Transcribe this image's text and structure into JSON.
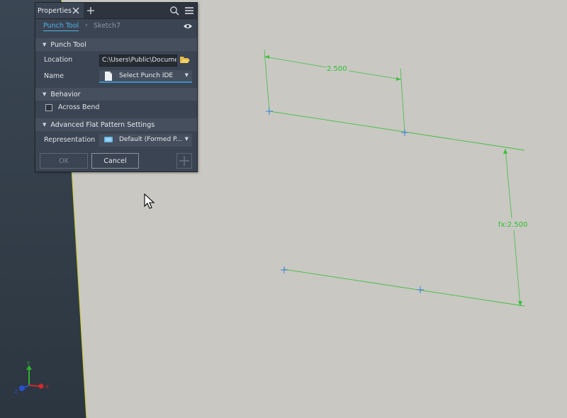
{
  "panel": {
    "tab_label": "Properties",
    "tab_close_icon": "close-icon",
    "tab_add_icon": "plus-icon",
    "search_icon": "search-icon",
    "menu_icon": "hamburger-menu-icon",
    "breadcrumb": {
      "active": "Punch Tool",
      "next": "Sketch7",
      "eye_icon": "eye-icon"
    },
    "sections": {
      "punch_tool": "Punch Tool",
      "behavior": "Behavior",
      "advanced": "Advanced Flat Pattern Settings"
    },
    "location": {
      "label": "Location",
      "value": "C:\\Users\\Public\\Documer",
      "folder_icon": "folder-open-icon"
    },
    "name": {
      "label": "Name",
      "value": "Select Punch IDE",
      "icon": "document-icon"
    },
    "across_bend": {
      "label": "Across Bend",
      "checked": false
    },
    "representation": {
      "label": "Representation",
      "value": "Default (Formed P...",
      "icon": "flat-pattern-icon"
    },
    "buttons": {
      "ok": "OK",
      "cancel": "Cancel",
      "plus_icon": "plus-icon"
    }
  },
  "sketch": {
    "dim_horizontal": "2.500",
    "dim_vertical": "fx:2.500"
  },
  "triad": {
    "x_label": "X",
    "y_label": "Y",
    "z_label": "Z"
  },
  "colors": {
    "dimension": "#2fc02f",
    "point": "#3a7fd8",
    "accent": "#4fb3e6",
    "canvas": "#c9c8c3"
  }
}
